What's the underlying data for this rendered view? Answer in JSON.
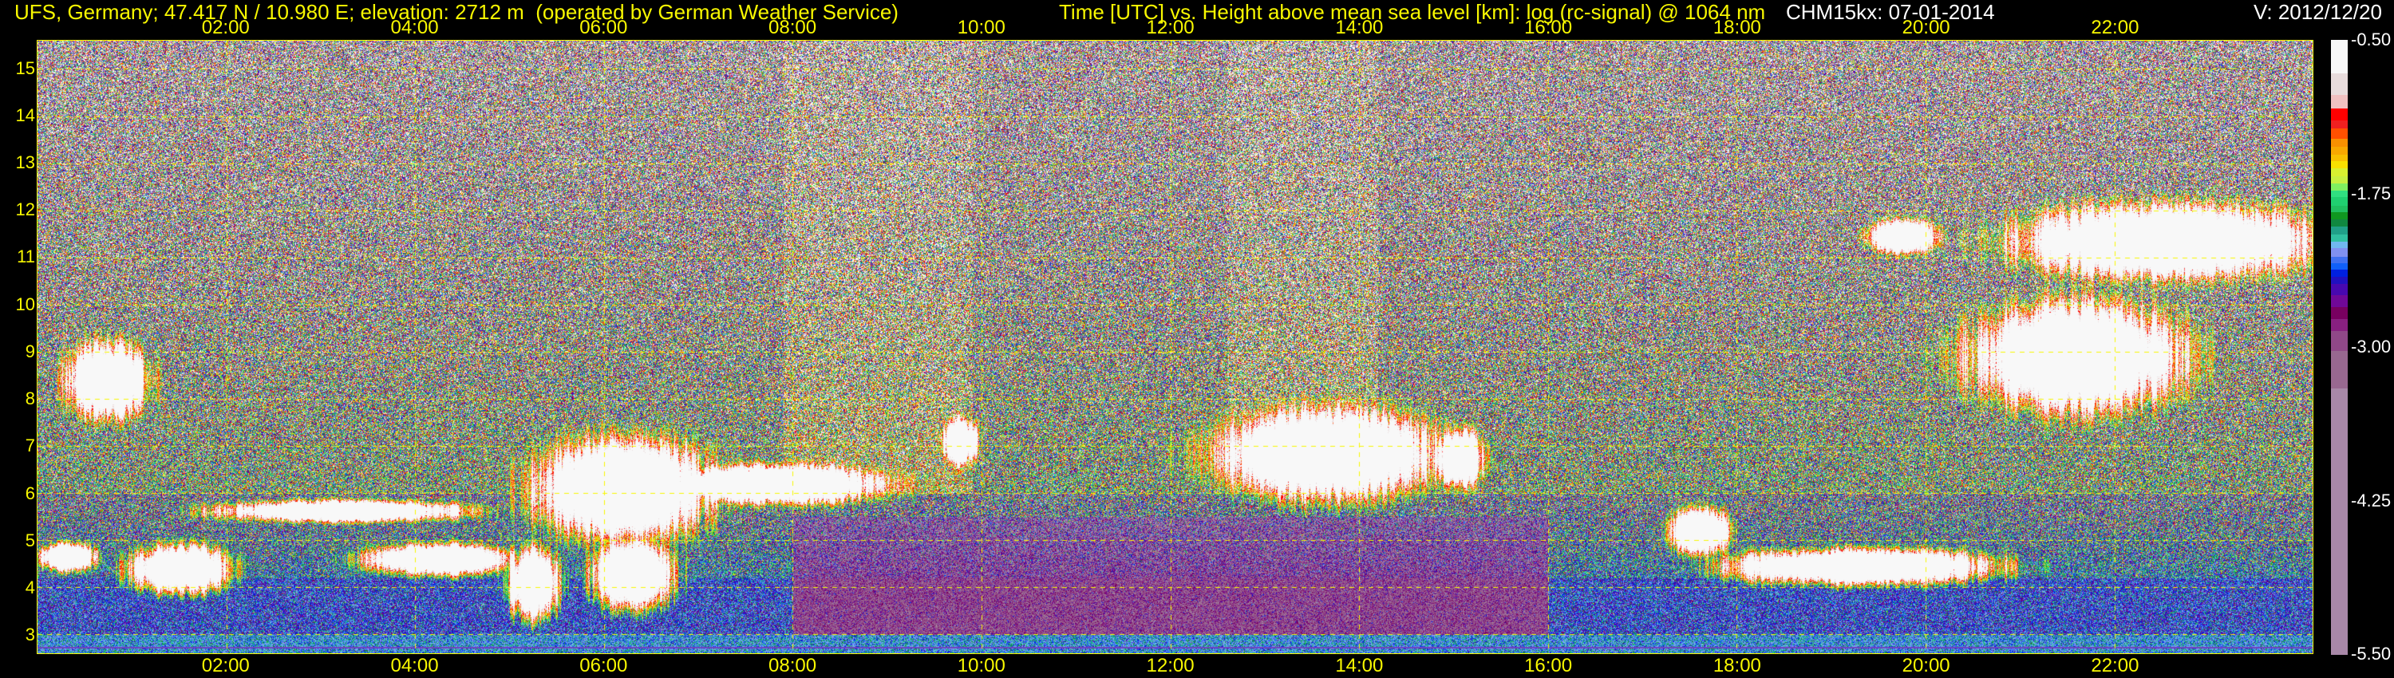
{
  "header": {
    "site": "UFS, Germany; 47.417 N / 10.980 E; elevation: 2712 m  (operated by German Weather Service)",
    "axes_title": "Time [UTC] vs. Height above mean sea level [km]: log (rc-signal) @ 1064 nm",
    "instrument_date": "CHM15kx: 07-01-2014",
    "version": "V: 2012/12/20"
  },
  "chart_data": {
    "type": "heatmap",
    "title": "Time [UTC] vs. Height above mean sea level [km]: log (rc-signal) @ 1064 nm",
    "x_ticks": [
      "02:00",
      "04:00",
      "06:00",
      "08:00",
      "10:00",
      "12:00",
      "14:00",
      "16:00",
      "18:00",
      "20:00",
      "22:00"
    ],
    "x_tick_hours": [
      2,
      4,
      6,
      8,
      10,
      12,
      14,
      16,
      18,
      20,
      22
    ],
    "xlim_hours": [
      0,
      24.1
    ],
    "y_ticks": [
      "3",
      "4",
      "5",
      "6",
      "7",
      "8",
      "9",
      "10",
      "11",
      "12",
      "13",
      "14",
      "15"
    ],
    "ylim_km": [
      2.6,
      15.6
    ],
    "grid": true,
    "colorbar": {
      "ticks": [
        "-0.50",
        "-1.75",
        "-3.00",
        "-4.25",
        "-5.50"
      ],
      "range": [
        -5.5,
        -0.5
      ],
      "colors": [
        "#f8f8f8",
        "#e8dcdc",
        "#f0c0c0",
        "#ff0000",
        "#f02020",
        "#ff5000",
        "#f89000",
        "#f8a800",
        "#f8c000",
        "#f8e000",
        "#d8f030",
        "#c8f040",
        "#80f060",
        "#30e080",
        "#20d070",
        "#20c060",
        "#109820",
        "#108840",
        "#20a088",
        "#30c0a0",
        "#70b8f0",
        "#8090f0",
        "#4070f0",
        "#1060f8",
        "#0020e0",
        "#2010c0",
        "#4808b0",
        "#700898",
        "#780060",
        "#882080",
        "#904888",
        "#986890",
        "#a888a8"
      ]
    },
    "cloud_layers_utc_km": [
      {
        "start": 0.33,
        "end": 1.15,
        "base": 7.4,
        "top": 9.4
      },
      {
        "start": 0.0,
        "end": 0.6,
        "base": 4.3,
        "top": 5.0
      },
      {
        "start": 1.0,
        "end": 2.0,
        "base": 3.8,
        "top": 5.0
      },
      {
        "start": 2.0,
        "end": 4.5,
        "base": 5.35,
        "top": 5.9
      },
      {
        "start": 3.5,
        "end": 5.0,
        "base": 4.2,
        "top": 5.0
      },
      {
        "start": 5.0,
        "end": 5.5,
        "base": 3.2,
        "top": 5.0
      },
      {
        "start": 5.3,
        "end": 7.1,
        "base": 4.8,
        "top": 7.4
      },
      {
        "start": 5.9,
        "end": 6.7,
        "base": 3.4,
        "top": 5.2
      },
      {
        "start": 6.5,
        "end": 9.0,
        "base": 5.7,
        "top": 6.7
      },
      {
        "start": 9.6,
        "end": 9.95,
        "base": 6.5,
        "top": 7.7
      },
      {
        "start": 12.5,
        "end": 14.8,
        "base": 5.7,
        "top": 8.0
      },
      {
        "start": 14.8,
        "end": 15.3,
        "base": 6.0,
        "top": 7.5
      },
      {
        "start": 17.3,
        "end": 17.9,
        "base": 4.6,
        "top": 5.8
      },
      {
        "start": 18.0,
        "end": 20.7,
        "base": 4.0,
        "top": 4.9
      },
      {
        "start": 20.5,
        "end": 22.7,
        "base": 7.5,
        "top": 10.3
      },
      {
        "start": 21.0,
        "end": 24.1,
        "base": 10.4,
        "top": 12.3
      },
      {
        "start": 19.4,
        "end": 20.1,
        "base": 11.0,
        "top": 11.9
      }
    ]
  }
}
